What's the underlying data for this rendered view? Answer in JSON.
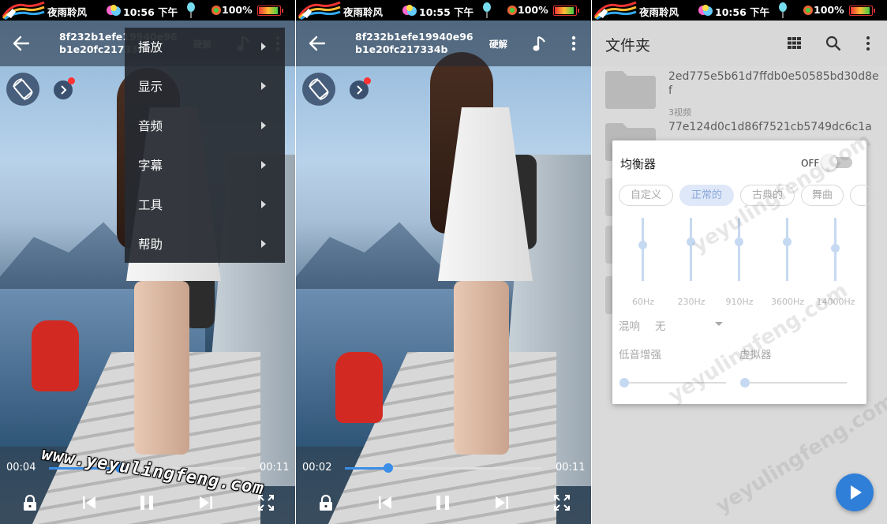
{
  "status_bars": [
    {
      "carrier": "夜雨聆风",
      "time": "10:56 下午",
      "battery": "100%"
    },
    {
      "carrier": "夜雨聆风",
      "time": "10:55 下午",
      "battery": "100%"
    },
    {
      "carrier": "夜雨聆风",
      "time": "10:56 下午",
      "battery": "100%"
    }
  ],
  "player1": {
    "title": "8f232b1efe19940e96b1e20fc217334b",
    "hw_label": "硬解",
    "elapsed": "00:04",
    "duration": "00:11",
    "progress": 0.36,
    "menu": [
      "播放",
      "显示",
      "音频",
      "字幕",
      "工具",
      "帮助"
    ],
    "watermark": "www.yeyulingfeng.com"
  },
  "player2": {
    "title": "8f232b1efe19940e96b1e20fc217334b",
    "hw_label": "硬解",
    "elapsed": "00:02",
    "duration": "00:11",
    "progress": 0.22
  },
  "folder_screen": {
    "title": "文件夹",
    "folders": [
      {
        "name": "2ed775e5b61d7ffdb0e50585bd30d8ef",
        "count": "3视频"
      },
      {
        "name": "77e124d0c1d86f7521cb5749dc6c1a",
        "count": ""
      }
    ],
    "equalizer": {
      "title": "均衡器",
      "switch_label": "OFF",
      "presets": [
        "自定义",
        "正常的",
        "古典的",
        "舞曲"
      ],
      "selected_preset": "正常的",
      "bands": [
        {
          "freq": "60Hz",
          "level": 0.45
        },
        {
          "freq": "230Hz",
          "level": 0.5
        },
        {
          "freq": "910Hz",
          "level": 0.5
        },
        {
          "freq": "3600Hz",
          "level": 0.5
        },
        {
          "freq": "14000Hz",
          "level": 0.4
        }
      ],
      "reverb_label": "混响",
      "reverb_value": "无",
      "bass_label": "低音增强",
      "virtualizer_label": "虚拟器",
      "bass_level": 0.0,
      "virtualizer_level": 0.0
    }
  },
  "colors": {
    "accent": "#3a8ee6",
    "fab": "#2f7fd8",
    "menu_bg": "#26292f"
  },
  "icons": [
    "back-arrow-icon",
    "music-note-icon",
    "more-vert-icon",
    "screen-rotate-icon",
    "chevron-right-icon",
    "lock-icon",
    "skip-previous-icon",
    "pause-icon",
    "skip-next-icon",
    "fullscreen-icon",
    "grid-view-icon",
    "search-icon",
    "folder-icon",
    "play-icon"
  ]
}
